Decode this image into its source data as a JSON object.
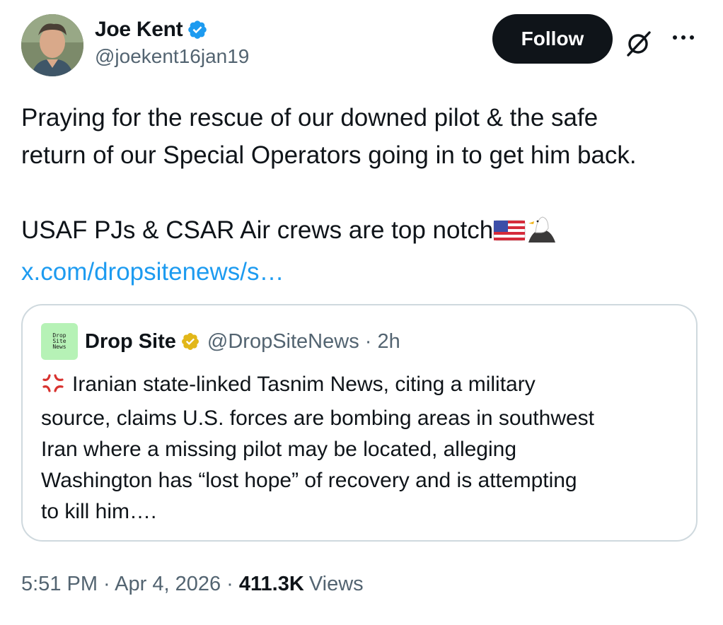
{
  "author": {
    "name": "Joe Kent",
    "handle": "@joekent16jan19",
    "verified_color": "#1d9bf0"
  },
  "actions": {
    "follow_label": "Follow",
    "grok_icon": "grok-icon",
    "more_icon": "more-horizontal-icon"
  },
  "tweet": {
    "lines": [
      "Praying for the rescue of our downed pilot & the safe",
      "return of our Special Operators going in to get him back."
    ],
    "line3": "USAF PJs & CSAR Air crews are top notch",
    "emojis": [
      "us-flag-icon",
      "eagle-icon"
    ],
    "link": "x.com/dropsitenews/s…"
  },
  "quote": {
    "name": "Drop Site",
    "handle_time": "@DropSiteNews · 2h",
    "logo_lines": [
      "Drop",
      "Site",
      "News"
    ],
    "badge_color": "#e2b719",
    "emoji": "anger-symbol-icon",
    "lines": [
      "Iranian state-linked Tasnim News, citing a military",
      "source, claims U.S. forces are bombing areas in southwest",
      "Iran where a missing pilot may be located, alleging",
      "Washington has “lost hope” of recovery and is attempting",
      "to kill him…."
    ]
  },
  "meta": {
    "time_date": "5:51 PM · Apr 4, 2026 · ",
    "views_count": "411.3K",
    "views_label": "Views"
  },
  "colors": {
    "text": "#0f1419",
    "secondary": "#536471",
    "link": "#1d9bf0",
    "border": "#cfd9de"
  }
}
